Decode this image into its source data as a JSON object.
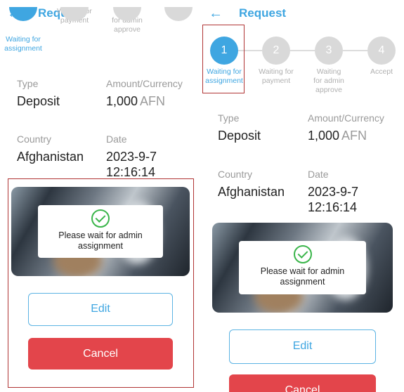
{
  "header": {
    "back_icon": "arrow-left-icon",
    "title": "Request"
  },
  "steps": [
    {
      "number": "1",
      "label_lines": [
        "Waiting for",
        "assignment"
      ],
      "active": true
    },
    {
      "number": "2",
      "label_lines": [
        "Waiting for",
        "payment"
      ],
      "active": false
    },
    {
      "number": "3",
      "label_lines": [
        "Waiting",
        "for admin",
        "approve"
      ],
      "active": false
    },
    {
      "number": "4",
      "label_lines": [
        "Accept"
      ],
      "active": false
    }
  ],
  "details": {
    "type_label": "Type",
    "type_value": "Deposit",
    "amount_label": "Amount/Currency",
    "amount_value": "1,000",
    "currency": "AFN",
    "country_label": "Country",
    "country_value": "Afghanistan",
    "date_label": "Date",
    "date_line1": "2023-9-7",
    "date_line2": "12:16:14"
  },
  "notice": {
    "icon": "check-circle-icon",
    "line1": "Please wait for admin",
    "line2": "assignment"
  },
  "actions": {
    "edit_label": "Edit",
    "cancel_label": "Cancel"
  },
  "colors": {
    "accent": "#3fa6e1",
    "danger": "#e3454b",
    "success": "#3ab54a",
    "highlight_box": "#b03434"
  }
}
